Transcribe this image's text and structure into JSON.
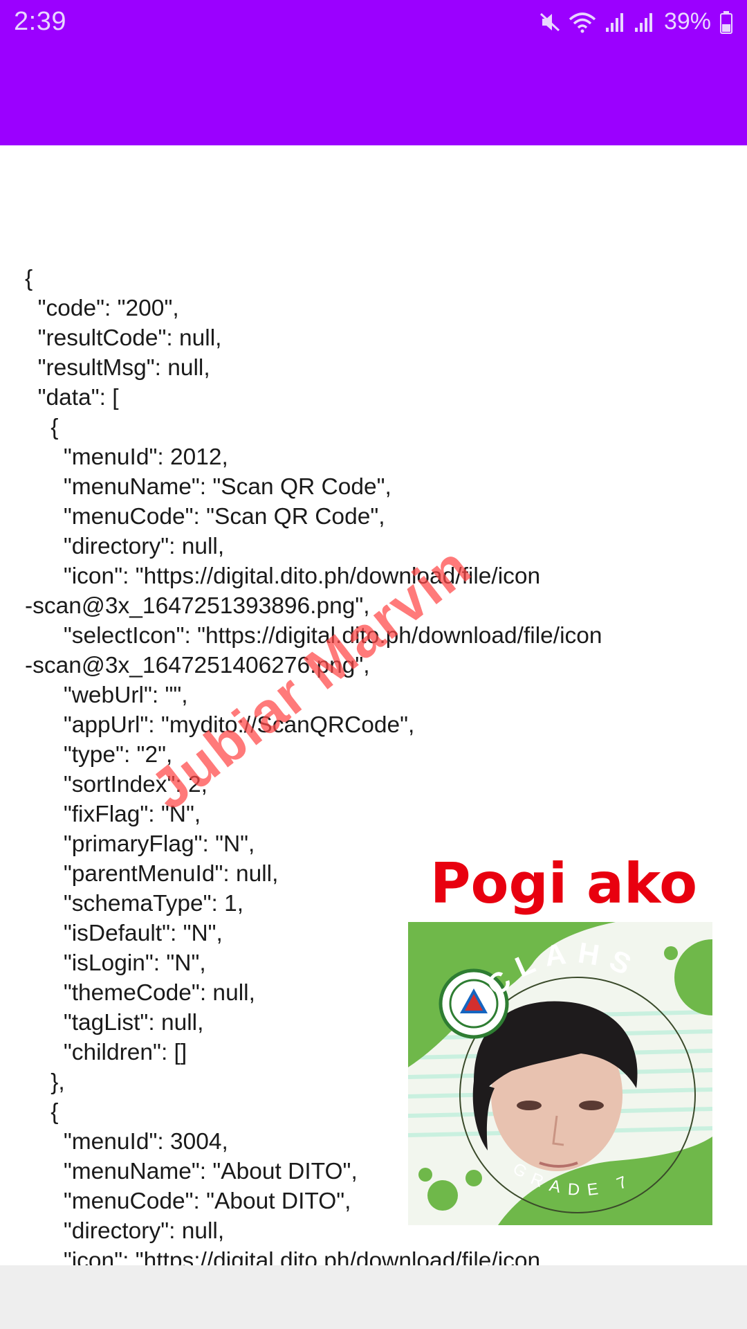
{
  "status_bar": {
    "time": "2:39",
    "battery_percent": "39%",
    "icons": [
      "mute-icon",
      "wifi-icon",
      "signal-icon",
      "signal-icon",
      "battery-icon"
    ]
  },
  "colors": {
    "app_bar": "#9b00ff",
    "watermark": "#ff4646",
    "caption": "#e8000f",
    "sticker_green": "#6fb84a"
  },
  "content": {
    "json_lines": [
      "{",
      "  \"code\": \"200\",",
      "  \"resultCode\": null,",
      "  \"resultMsg\": null,",
      "  \"data\": [",
      "    {",
      "      \"menuId\": 2012,",
      "      \"menuName\": \"Scan QR Code\",",
      "      \"menuCode\": \"Scan QR Code\",",
      "      \"directory\": null,",
      "      \"icon\": \"https://digital.dito.ph/download/file/icon",
      "-scan@3x_1647251393896.png\",",
      "      \"selectIcon\": \"https://digital.dito.ph/download/file/icon",
      "-scan@3x_1647251406276.png\",",
      "      \"webUrl\": \"\",",
      "      \"appUrl\": \"mydito://ScanQRCode\",",
      "      \"type\": \"2\",",
      "      \"sortIndex\": 2,",
      "      \"fixFlag\": \"N\",",
      "      \"primaryFlag\": \"N\",",
      "      \"parentMenuId\": null,",
      "      \"schemaType\": 1,",
      "      \"isDefault\": \"N\",",
      "      \"isLogin\": \"N\",",
      "      \"themeCode\": null,",
      "      \"tagList\": null,",
      "      \"children\": []",
      "    },",
      "    {",
      "      \"menuId\": 3004,",
      "      \"menuName\": \"About DITO\",",
      "      \"menuCode\": \"About DITO\",",
      "      \"directory\": null,",
      "      \"icon\": \"https://digital.dito.ph/download/file/icon"
    ]
  },
  "overlay": {
    "watermark": "Jubiar Marvin",
    "caption": "Pogi ako",
    "badge_top": "CLAHS",
    "badge_bottom": "GRADE 7"
  }
}
